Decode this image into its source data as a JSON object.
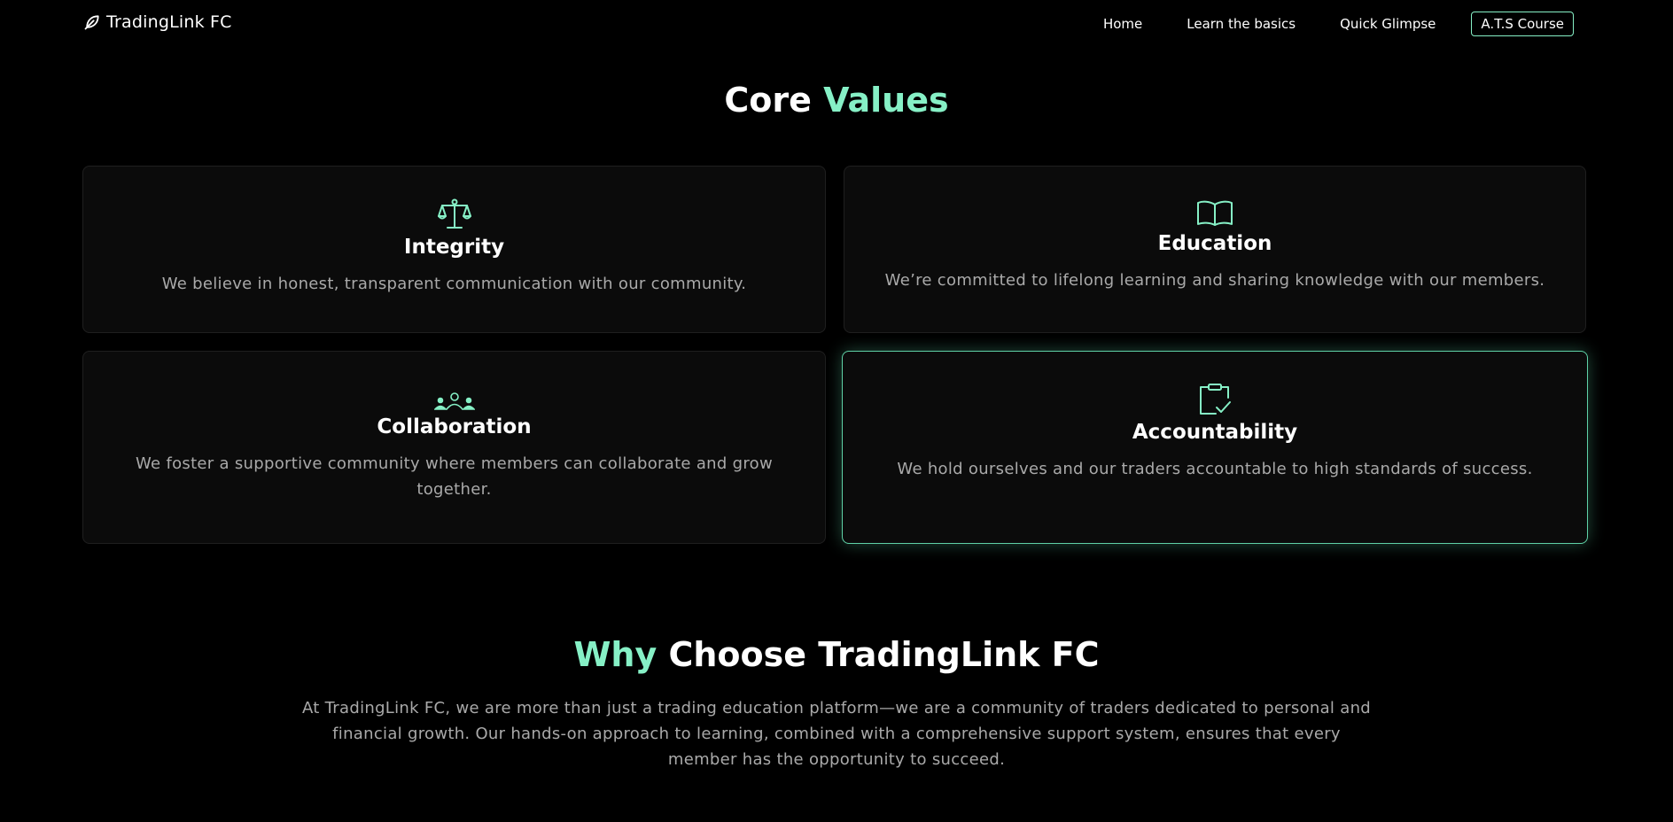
{
  "nav": {
    "brand_icon": "leaf-icon",
    "brand_name": "TradingLink FC",
    "links": [
      "Home",
      "Learn the basics",
      "Quick Glimpse"
    ],
    "cta_label": "A.T.S Course"
  },
  "core_values": {
    "title_part1": "Core",
    "title_part2": "Values",
    "cards": [
      {
        "icon": "scale-icon",
        "title": "Integrity",
        "description": "We believe in honest, transparent communication with our community."
      },
      {
        "icon": "open-book-icon",
        "title": "Education",
        "description": "We’re committed to lifelong learning and sharing knowledge with our members."
      },
      {
        "icon": "people-group-icon",
        "title": "Collaboration",
        "description": "We foster a supportive community where members can collaborate and grow together."
      },
      {
        "icon": "clipboard-check-icon",
        "title": "Accountability",
        "description": "We hold ourselves and our traders accountable to high standards of success."
      }
    ]
  },
  "why": {
    "title_part1": "Why",
    "title_part2": "Choose TradingLink FC",
    "description": "At TradingLink FC, we are more than just a trading education platform—we are a community of traders dedicated to personal and financial growth. Our hands-on approach to learning, combined with a comprehensive support system, ensures that every member has the opportunity to succeed."
  },
  "colors": {
    "accent": "#86f0c6",
    "background": "#000000",
    "card_background": "#0b0b0b",
    "muted_text": "#a9a9a9"
  }
}
